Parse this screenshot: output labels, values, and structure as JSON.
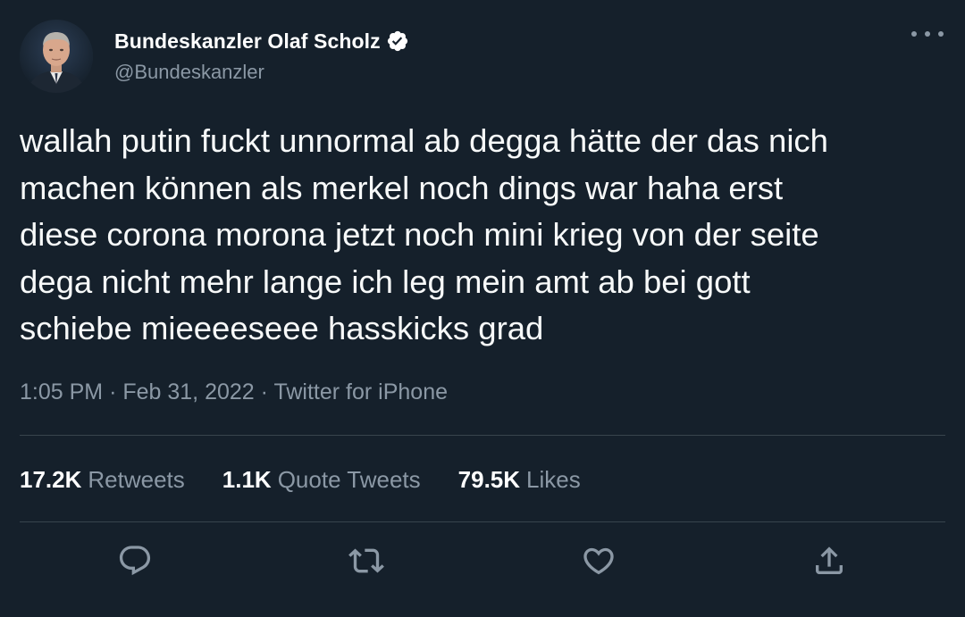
{
  "author": {
    "display_name": "Bundeskanzler Olaf Scholz",
    "handle": "@Bundeskanzler",
    "verified": true,
    "avatar_icon": "avatar-portrait-icon"
  },
  "tweet": {
    "text": "wallah putin fuckt unnormal ab degga hätte der das nich\nmachen können als merkel noch dings war haha erst\ndiese corona morona jetzt noch mini krieg von der seite\ndega nicht mehr lange ich leg mein amt ab bei gott\nschiebe mieeeeseee hasskicks grad",
    "time": "1:05 PM",
    "separator": "·",
    "date": "Feb 31, 2022",
    "source": "Twitter for iPhone"
  },
  "stats": {
    "retweets_count": "17.2K",
    "retweets_label": "Retweets",
    "quote_tweets_count": "1.1K",
    "quote_tweets_label": "Quote Tweets",
    "likes_count": "79.5K",
    "likes_label": "Likes"
  },
  "actions": [
    "reply-icon",
    "retweet-icon",
    "like-icon",
    "share-icon"
  ],
  "colors": {
    "background": "#15202b",
    "text_primary": "#f7f9f9",
    "text_secondary": "#8b98a5",
    "divider": "#38444d"
  }
}
